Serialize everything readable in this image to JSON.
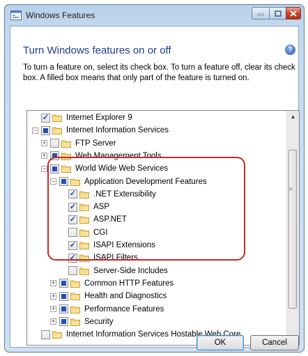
{
  "window": {
    "title": "Windows Features",
    "heading": "Turn Windows features on or off",
    "description": "To turn a feature on, select its check box. To turn a feature off, clear its check box. A filled box means that only part of the feature is turned on."
  },
  "tree": [
    {
      "label": "Internet Explorer 9",
      "level": 0,
      "expander": "none",
      "state": "checked"
    },
    {
      "label": "Internet Information Services",
      "level": 0,
      "expander": "minus",
      "state": "partial"
    },
    {
      "label": "FTP Server",
      "level": 1,
      "expander": "plus",
      "state": "unchecked"
    },
    {
      "label": "Web Management Tools",
      "level": 1,
      "expander": "plus",
      "state": "partial"
    },
    {
      "label": "World Wide Web Services",
      "level": 1,
      "expander": "minus",
      "state": "partial"
    },
    {
      "label": "Application Development Features",
      "level": 2,
      "expander": "minus",
      "state": "partial"
    },
    {
      "label": ".NET Extensibility",
      "level": 3,
      "expander": "none",
      "state": "checked"
    },
    {
      "label": "ASP",
      "level": 3,
      "expander": "none",
      "state": "checked"
    },
    {
      "label": "ASP.NET",
      "level": 3,
      "expander": "none",
      "state": "checked"
    },
    {
      "label": "CGI",
      "level": 3,
      "expander": "none",
      "state": "unchecked"
    },
    {
      "label": "ISAPI Extensions",
      "level": 3,
      "expander": "none",
      "state": "checked"
    },
    {
      "label": "ISAPI Filters",
      "level": 3,
      "expander": "none",
      "state": "checked"
    },
    {
      "label": "Server-Side Includes",
      "level": 3,
      "expander": "none",
      "state": "unchecked"
    },
    {
      "label": "Common HTTP Features",
      "level": 2,
      "expander": "plus",
      "state": "partial"
    },
    {
      "label": "Health and Diagnostics",
      "level": 2,
      "expander": "plus",
      "state": "partial"
    },
    {
      "label": "Performance Features",
      "level": 2,
      "expander": "plus",
      "state": "partial"
    },
    {
      "label": "Security",
      "level": 2,
      "expander": "plus",
      "state": "partial"
    },
    {
      "label": "Internet Information Services Hostable Web Core",
      "level": 0,
      "expander": "none",
      "state": "unchecked"
    }
  ],
  "buttons": {
    "ok": "OK",
    "cancel": "Cancel"
  },
  "icons": {
    "help": "?",
    "minimize": "minimize-icon",
    "maximize": "maximize-icon",
    "close": "close-icon"
  },
  "colors": {
    "heading": "#1f3f8f",
    "highlight": "#c12a2a",
    "check": "#1b3fa6"
  }
}
